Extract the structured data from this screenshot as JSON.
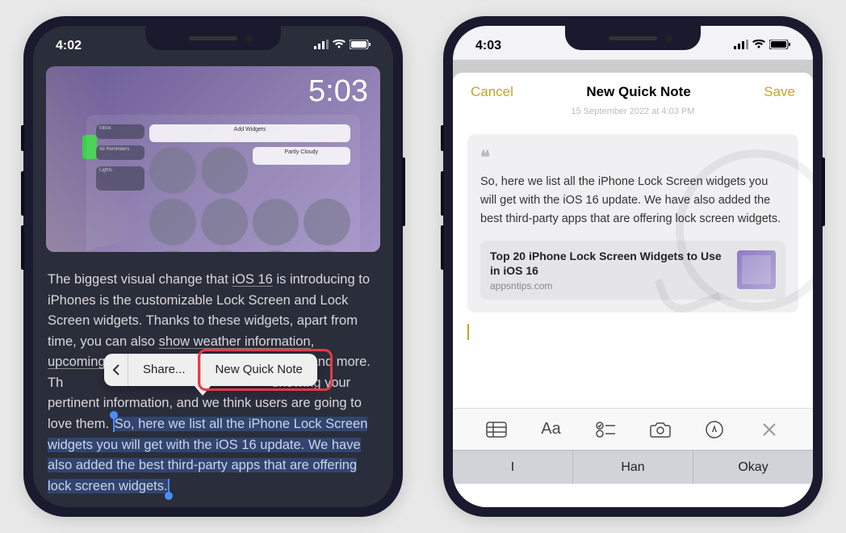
{
  "phone1": {
    "status": {
      "time": "4:02"
    },
    "hero": {
      "time_overlay": "5:03",
      "add_widgets": "Add Widgets"
    },
    "article": {
      "p1_prefix": "The biggest visual change that ",
      "p1_link1": "iOS 16",
      "p1_mid1": " is introducing to iPhones is the customizable Lock Screen and Lock Screen widgets. Thanks to these widgets, apart from time, you can also ",
      "p1_link2": "show weather information",
      "p1_end1": ", ",
      "p2_link1": "upcoming",
      "p2_mid": "s, and more. Th",
      "p2_mid2": "showing your pertinent information, and we think users are going to love them. ",
      "selected": "So, here we list all the iPhone Lock Screen widgets you will get with the iOS 16 update. We have also added the best third-party apps that are offering lock screen widgets."
    },
    "context_menu": {
      "share": "Share...",
      "quick_note": "New Quick Note"
    }
  },
  "phone2": {
    "status": {
      "time": "4:03"
    },
    "nav": {
      "cancel": "Cancel",
      "title": "New Quick Note",
      "save": "Save",
      "subtitle": "15 September 2022 at 4:03 PM"
    },
    "quote": {
      "text": "So, here we list all the iPhone Lock Screen widgets you will get with the iOS 16 update. We have also added the best third-party apps that are offering lock screen widgets."
    },
    "link": {
      "title": "Top 20 iPhone Lock Screen Widgets to Use in iOS 16",
      "domain": "appsntips.com"
    },
    "toolbar": {
      "format_label": "Aa"
    },
    "suggestions": [
      "I",
      "Han",
      "Okay"
    ]
  }
}
